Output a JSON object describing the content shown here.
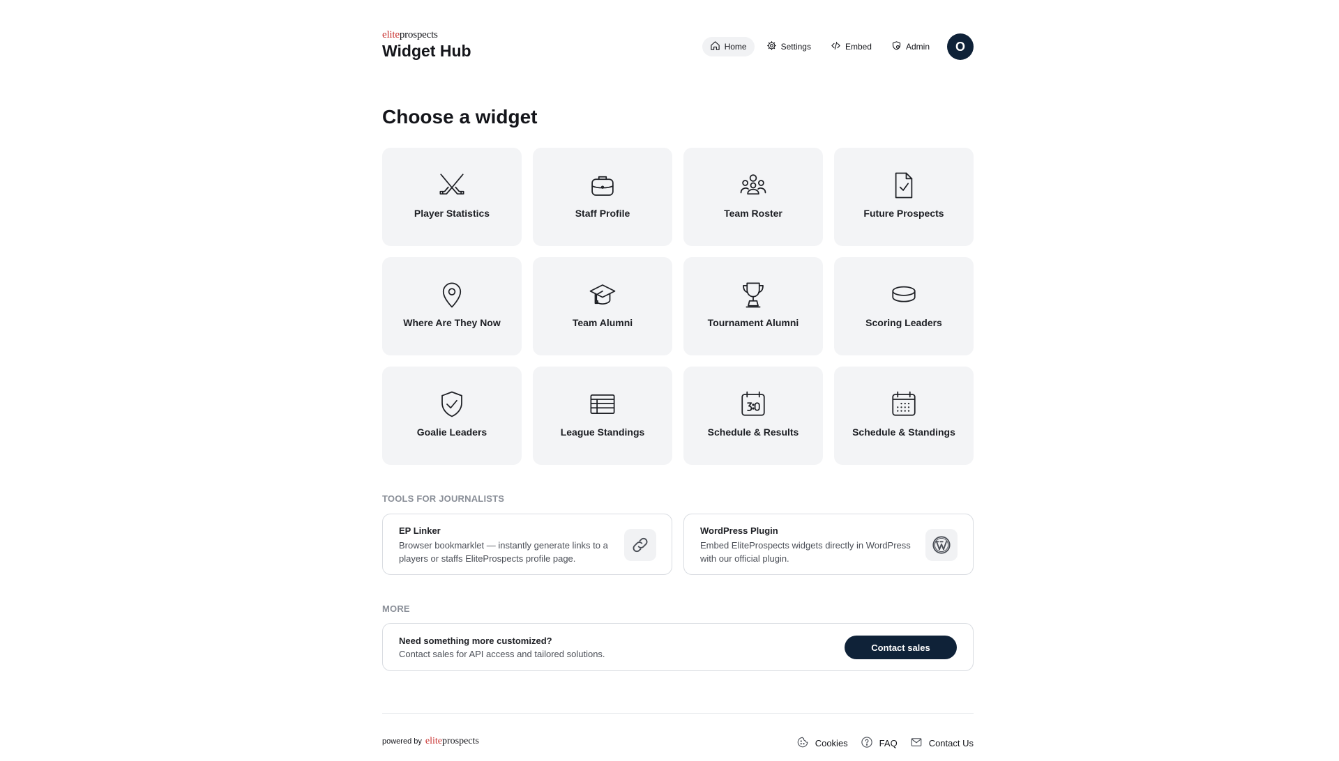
{
  "brand": {
    "logo_elite": "elite",
    "logo_prospects": "prospects",
    "title": "Widget Hub"
  },
  "nav": {
    "items": [
      {
        "label": "Home",
        "icon": "home-icon",
        "active": true
      },
      {
        "label": "Settings",
        "icon": "gear-icon",
        "active": false
      },
      {
        "label": "Embed",
        "icon": "code-icon",
        "active": false
      },
      {
        "label": "Admin",
        "icon": "admin-icon",
        "active": false
      }
    ],
    "avatar_initial": "O"
  },
  "main": {
    "title": "Choose a widget",
    "widgets": [
      {
        "label": "Player Statistics",
        "icon": "hockey-sticks-icon"
      },
      {
        "label": "Staff Profile",
        "icon": "briefcase-icon"
      },
      {
        "label": "Team Roster",
        "icon": "team-icon"
      },
      {
        "label": "Future Prospects",
        "icon": "document-check-icon"
      },
      {
        "label": "Where Are They Now",
        "icon": "location-pin-icon"
      },
      {
        "label": "Team Alumni",
        "icon": "graduation-cap-icon"
      },
      {
        "label": "Tournament Alumni",
        "icon": "trophy-icon"
      },
      {
        "label": "Scoring Leaders",
        "icon": "puck-icon"
      },
      {
        "label": "Goalie Leaders",
        "icon": "shield-check-icon"
      },
      {
        "label": "League Standings",
        "icon": "table-icon"
      },
      {
        "label": "Schedule & Results",
        "icon": "calendar-score-icon"
      },
      {
        "label": "Schedule & Standings",
        "icon": "calendar-grid-icon"
      }
    ]
  },
  "tools": {
    "heading": "TOOLS FOR JOURNALISTS",
    "items": [
      {
        "name": "EP Linker",
        "description": "Browser bookmarklet — instantly generate links to a players or staffs EliteProspects profile page.",
        "icon": "link-icon"
      },
      {
        "name": "WordPress Plugin",
        "description": "Embed EliteProspects widgets directly in WordPress with our official plugin.",
        "icon": "wordpress-icon"
      }
    ]
  },
  "more": {
    "heading": "MORE",
    "title": "Need something more customized?",
    "description": "Contact sales for API access and tailored solutions.",
    "button_label": "Contact sales"
  },
  "footer": {
    "powered_by": "powered by",
    "logo_elite": "elite",
    "logo_prospects": "prospects",
    "links": [
      {
        "label": "Cookies",
        "icon": "cookie-icon"
      },
      {
        "label": "FAQ",
        "icon": "help-circle-icon"
      },
      {
        "label": "Contact Us",
        "icon": "mail-icon"
      }
    ]
  },
  "colors": {
    "brand_red": "#c8312f",
    "navy": "#0f2238",
    "tile_bg": "#f3f4f6"
  }
}
